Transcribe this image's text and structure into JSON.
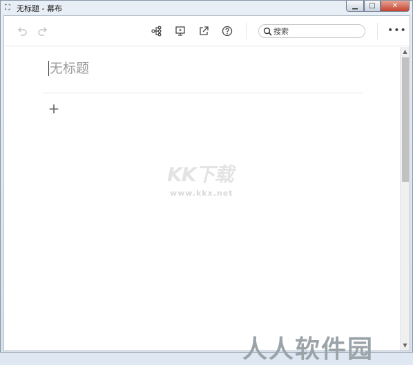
{
  "window": {
    "title": "无标题 - 幕布",
    "app_icon": "app-logo-icon"
  },
  "toolbar": {
    "undo_icon": "undo-icon",
    "redo_icon": "redo-icon",
    "mindmap_icon": "mindmap-icon",
    "present_icon": "presentation-icon",
    "share_icon": "share-icon",
    "help_icon": "help-icon",
    "more_label": "•••"
  },
  "search": {
    "placeholder": "搜索"
  },
  "document": {
    "title": "无标题",
    "add_label": "+"
  },
  "watermarks": {
    "kkx_text": "KK下载",
    "kkx_url": "www.kkx.net",
    "rr_text": "人人软件园"
  }
}
